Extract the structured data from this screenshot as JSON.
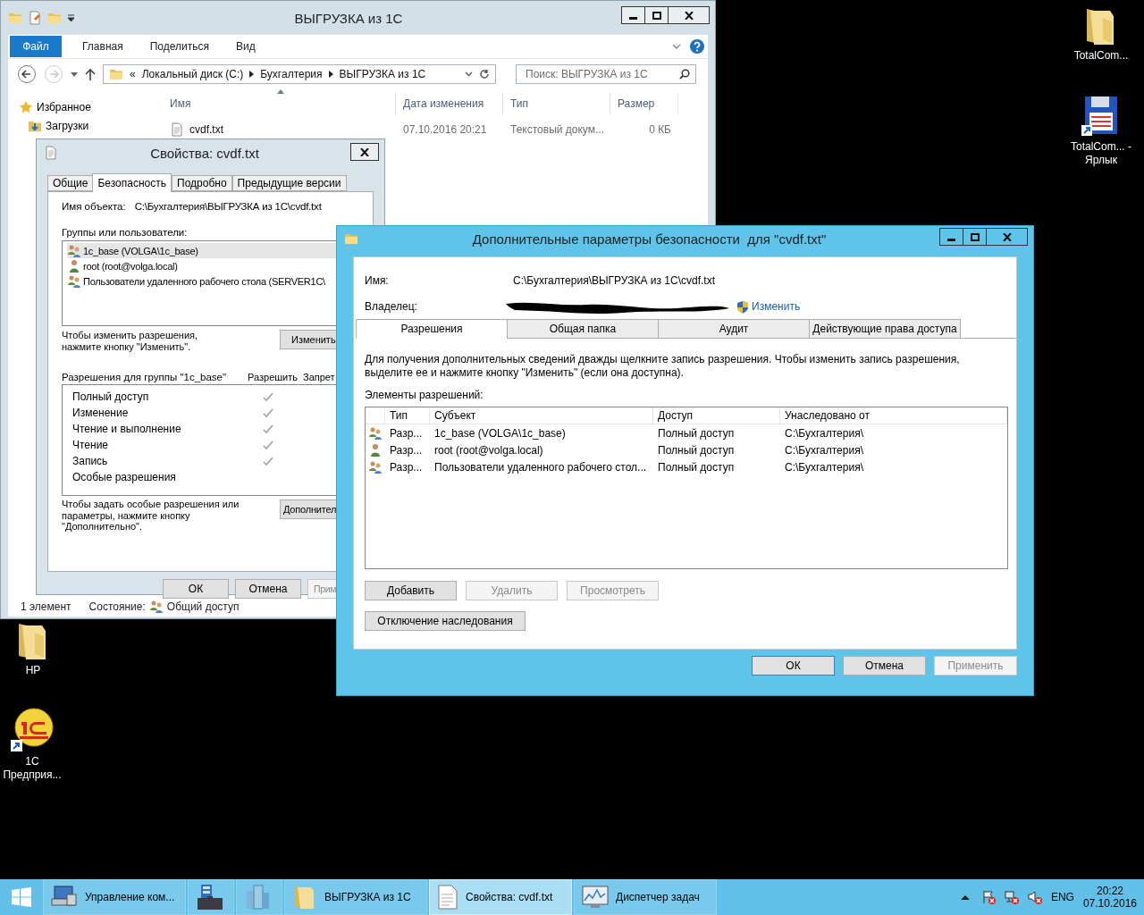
{
  "desktop_icons": [
    {
      "label": "TotalCom...",
      "kind": "folder"
    },
    {
      "label": "TotalCom... - Ярлык",
      "kind": "floppy-shortcut"
    },
    {
      "label": "HP",
      "kind": "folder"
    },
    {
      "label": "1С Предприя...",
      "kind": "app-shortcut"
    }
  ],
  "explorer": {
    "title": "ВЫГРУЗКА из 1С",
    "file_tab": "Файл",
    "ribbon_tabs": [
      "Главная",
      "Поделиться",
      "Вид"
    ],
    "address": {
      "overflow": "«",
      "crumbs": [
        "Локальный диск (C:)",
        "Бухгалтерия",
        "ВЫГРУЗКА из 1С"
      ]
    },
    "search": {
      "placeholder": "Поиск: ВЫГРУЗКА из 1С"
    },
    "nav": [
      {
        "label": "Избранное",
        "kind": "favorites"
      },
      {
        "label": "Загрузки",
        "kind": "downloads"
      }
    ],
    "columns": [
      "Имя",
      "Дата изменения",
      "Тип",
      "Размер"
    ],
    "files": [
      {
        "name": "cvdf.txt",
        "date": "07.10.2016 20:21",
        "type": "Текстовый докум...",
        "size": "0 КБ"
      }
    ],
    "status": {
      "count": "1 элемент",
      "state_label": "Состояние:",
      "state": "Общий доступ"
    }
  },
  "properties": {
    "title": "Свойства: cvdf.txt",
    "tabs": [
      {
        "label": "Общие",
        "selected": false
      },
      {
        "label": "Безопасность",
        "selected": true
      },
      {
        "label": "Подробно",
        "selected": false
      },
      {
        "label": "Предыдущие версии",
        "selected": false
      }
    ],
    "object_label": "Имя объекта:",
    "object_path": "C:\\Бухгалтерия\\ВЫГРУЗКА из 1С\\cvdf.txt",
    "groups_label": "Группы или пользователи:",
    "principals": [
      {
        "name": "1c_base (VOLGA\\1c_base)",
        "kind": "group",
        "selected": true
      },
      {
        "name": "root (root@volga.local)",
        "kind": "user",
        "selected": false
      },
      {
        "name": "Пользователи удаленного рабочего стола (SERVER1C\\",
        "kind": "group",
        "selected": false
      }
    ],
    "change_hint": "Чтобы изменить разрешения,\nнажмите кнопку \"Изменить\".",
    "change_button": "Изменить",
    "perms_label": "Разрешения для группы \"1c_base\"",
    "allow_header": "Разрешить",
    "deny_header": "Запрет",
    "permissions": [
      {
        "name": "Полный доступ",
        "allow": true
      },
      {
        "name": "Изменение",
        "allow": true
      },
      {
        "name": "Чтение и выполнение",
        "allow": true
      },
      {
        "name": "Чтение",
        "allow": true
      },
      {
        "name": "Запись",
        "allow": true
      },
      {
        "name": "Особые разрешения",
        "allow": false
      }
    ],
    "special_hint": "Чтобы задать особые разрешения или\nпараметры, нажмите кнопку\n\"Дополнительно\".",
    "advanced_button": "Дополнител",
    "buttons": [
      {
        "label": "ОК",
        "disabled": false
      },
      {
        "label": "Отмена",
        "disabled": false
      },
      {
        "label": "Прим",
        "disabled": true
      }
    ]
  },
  "advanced": {
    "title": "Дополнительные параметры безопасности  для \"cvdf.txt\"",
    "name_label": "Имя:",
    "name_value": "C:\\Бухгалтерия\\ВЫГРУЗКА из 1С\\cvdf.txt",
    "owner_label": "Владелец:",
    "owner_redacted": true,
    "change_owner_link": "Изменить",
    "tabs": [
      {
        "label": "Разрешения",
        "selected": true
      },
      {
        "label": "Общая папка",
        "selected": false
      },
      {
        "label": "Аудит",
        "selected": false
      },
      {
        "label": "Действующие права доступа",
        "selected": false
      }
    ],
    "info": "Для получения дополнительных сведений дважды щелкните запись разрешения. Чтобы изменить запись разрешения, выделите ее и нажмите кнопку \"Изменить\" (если она доступна).",
    "entries_label": "Элементы разрешений:",
    "columns": [
      "Тип",
      "Субъект",
      "Доступ",
      "Унаследовано от"
    ],
    "entries": [
      {
        "kind": "group",
        "type": "Разр...",
        "principal": "1c_base (VOLGA\\1c_base)",
        "access": "Полный доступ",
        "inherited": "C:\\Бухгалтерия\\"
      },
      {
        "kind": "user",
        "type": "Разр...",
        "principal": "root (root@volga.local)",
        "access": "Полный доступ",
        "inherited": "C:\\Бухгалтерия\\"
      },
      {
        "kind": "group",
        "type": "Разр...",
        "principal": "Пользователи удаленного рабочего стол...",
        "access": "Полный доступ",
        "inherited": "C:\\Бухгалтерия\\"
      }
    ],
    "entry_buttons": [
      {
        "label": "Добавить",
        "disabled": false
      },
      {
        "label": "Удалить",
        "disabled": true
      },
      {
        "label": "Просмотреть",
        "disabled": true
      }
    ],
    "inheritance_button": "Отключение наследования",
    "buttons": [
      {
        "label": "ОК",
        "disabled": false
      },
      {
        "label": "Отмена",
        "disabled": false
      },
      {
        "label": "Применить",
        "disabled": true
      }
    ]
  },
  "taskbar": {
    "items": [
      {
        "kind": "computer-management",
        "label": "Управление ком...",
        "active": false
      },
      {
        "kind": "server-manager",
        "active": false
      },
      {
        "kind": "admin-tools",
        "active": false
      },
      {
        "kind": "folder",
        "label": "ВЫГРУЗКА из 1С",
        "active": false
      },
      {
        "kind": "document",
        "label": "Свойства: cvdf.txt",
        "active": true
      },
      {
        "kind": "task-manager",
        "label": "Диспетчер задач",
        "active": false
      }
    ],
    "tray": {
      "language": "ENG",
      "time": "20:22",
      "date": "07.10.2016"
    }
  }
}
